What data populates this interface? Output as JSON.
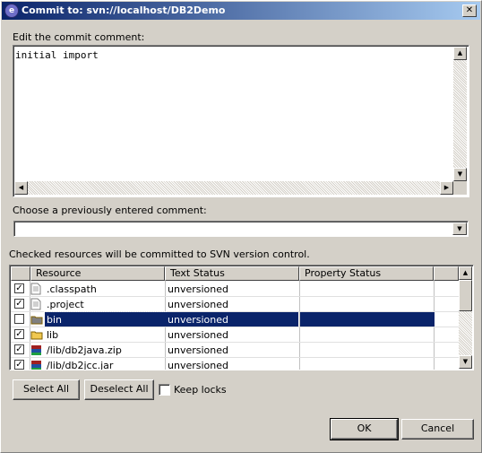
{
  "window": {
    "title": "Commit to: svn://localhost/DB2Demo"
  },
  "comment": {
    "label": "Edit the commit comment:",
    "text": "initial import"
  },
  "previous": {
    "label": "Choose a previously entered comment:",
    "value": ""
  },
  "resources": {
    "label": "Checked resources will be committed to SVN version control.",
    "columns": [
      "Resource",
      "Text Status",
      "Property Status"
    ],
    "rows": [
      {
        "checked": true,
        "icon": "file-icon",
        "name": ".classpath",
        "text_status": "unversioned",
        "prop_status": ""
      },
      {
        "checked": true,
        "icon": "file-icon",
        "name": ".project",
        "text_status": "unversioned",
        "prop_status": ""
      },
      {
        "checked": false,
        "icon": "folder-icon",
        "name": "bin",
        "text_status": "unversioned",
        "prop_status": "",
        "selected": true
      },
      {
        "checked": true,
        "icon": "folder-icon",
        "name": "lib",
        "text_status": "unversioned",
        "prop_status": ""
      },
      {
        "checked": true,
        "icon": "archive-icon",
        "name": "/lib/db2java.zip",
        "text_status": "unversioned",
        "prop_status": ""
      },
      {
        "checked": true,
        "icon": "archive-icon",
        "name": "/lib/db2jcc.jar",
        "text_status": "unversioned",
        "prop_status": ""
      }
    ]
  },
  "buttons": {
    "select_all": "Select All",
    "deselect_all": "Deselect All",
    "keep_locks": "Keep locks",
    "ok": "OK",
    "cancel": "Cancel"
  },
  "colors": {
    "selection": "#0a246a",
    "titlebar": "#0a246a"
  }
}
